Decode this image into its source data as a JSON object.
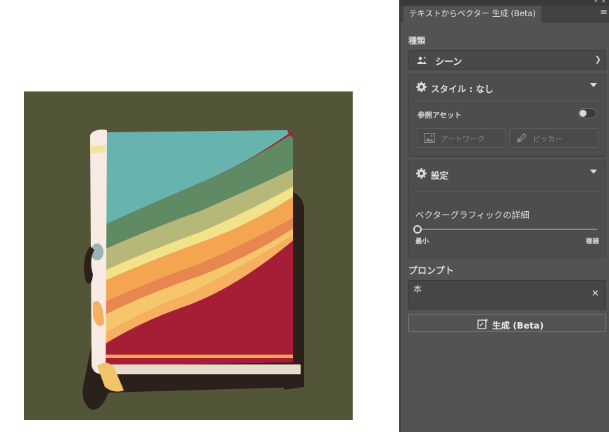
{
  "panel": {
    "tab_title": "テキストからベクター 生成 (Beta)",
    "type_label": "種類",
    "type_value": "シーン",
    "style": {
      "title": "スタイル : なし",
      "reference_label": "参照アセット",
      "reference_enabled": false,
      "artwork_button": "アートワーク",
      "picker_button": "ピッカー"
    },
    "settings": {
      "title": "設定",
      "detail_label": "ベクターグラフィックの詳細",
      "detail_min": "最小",
      "detail_max": "複雑",
      "detail_value": 0
    },
    "prompt_label": "プロンプト",
    "prompt_value": "本",
    "generate_button": "生成 (Beta)"
  },
  "colors": {
    "panel_bg": "#535353",
    "art_bg": "#525538",
    "book_cover_red": "#a51e35",
    "book_teal": "#67b3ad",
    "book_spine": "#f7ebe3"
  }
}
